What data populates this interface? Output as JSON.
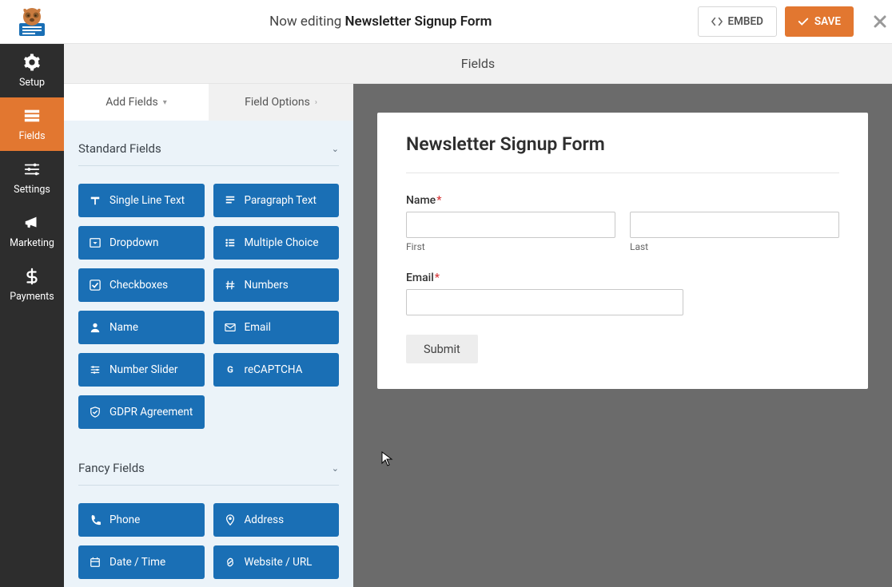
{
  "header": {
    "editing_prefix": "Now editing ",
    "form_name": "Newsletter Signup Form",
    "embed_label": "EMBED",
    "save_label": "SAVE"
  },
  "nav": {
    "setup": "Setup",
    "fields": "Fields",
    "settings": "Settings",
    "marketing": "Marketing",
    "payments": "Payments"
  },
  "builder_head": "Fields",
  "panel": {
    "tab_add": "Add Fields",
    "tab_options": "Field Options",
    "section_standard": "Standard Fields",
    "section_fancy": "Fancy Fields",
    "standard_items": [
      {
        "label": "Single Line Text",
        "icon": "text"
      },
      {
        "label": "Paragraph Text",
        "icon": "para"
      },
      {
        "label": "Dropdown",
        "icon": "caret"
      },
      {
        "label": "Multiple Choice",
        "icon": "list"
      },
      {
        "label": "Checkboxes",
        "icon": "check"
      },
      {
        "label": "Numbers",
        "icon": "hash"
      },
      {
        "label": "Name",
        "icon": "user"
      },
      {
        "label": "Email",
        "icon": "mail"
      },
      {
        "label": "Number Slider",
        "icon": "sliders"
      },
      {
        "label": "reCAPTCHA",
        "icon": "g"
      },
      {
        "label": "GDPR Agreement",
        "icon": "shield"
      }
    ],
    "fancy_items": [
      {
        "label": "Phone",
        "icon": "phone"
      },
      {
        "label": "Address",
        "icon": "pin"
      },
      {
        "label": "Date / Time",
        "icon": "cal"
      },
      {
        "label": "Website / URL",
        "icon": "link"
      }
    ]
  },
  "form": {
    "title": "Newsletter Signup Form",
    "name_label": "Name",
    "first_label": "First",
    "last_label": "Last",
    "email_label": "Email",
    "submit_label": "Submit"
  }
}
